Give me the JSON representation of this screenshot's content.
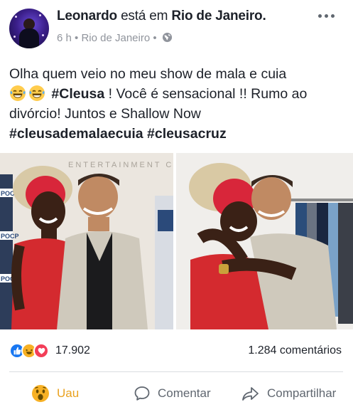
{
  "header": {
    "author": "Leonardo",
    "status_verb": "está em",
    "location": "Rio de Janeiro.",
    "timestamp": "6 h",
    "meta_location": "Rio de Janeiro",
    "privacy_icon": "globe-icon",
    "more_icon": "more-horizontal-icon"
  },
  "post": {
    "text_1": "Olha quem veio no meu show de mala e cuia",
    "emoji_icon": "laughing-tears-emoji",
    "hashtag_1": "#Cleusa",
    "text_2": " ! Você é sensacional !! Rumo ao divórcio! Juntos e Shallow Now",
    "hashtag_2": "#cleusademalaecuia",
    "hashtag_3": "#cleusacruz"
  },
  "photos": {
    "left_banner": "ENTERTAINMENT CENTER",
    "left_sign_1": "POCP",
    "left_sign_2": "POCP",
    "left_sign_3": "POCP"
  },
  "reactions": {
    "count": "17.902",
    "comments": "1.284 comentários",
    "icons": [
      "like-icon",
      "haha-icon",
      "love-icon"
    ]
  },
  "actions": {
    "wow": "Uau",
    "comment": "Comentar",
    "share": "Compartilhar"
  },
  "colors": {
    "link_blue": "#1877f2",
    "wow_yellow": "#f7b125",
    "love_red": "#f33e58",
    "muted_gray": "#90949c"
  }
}
